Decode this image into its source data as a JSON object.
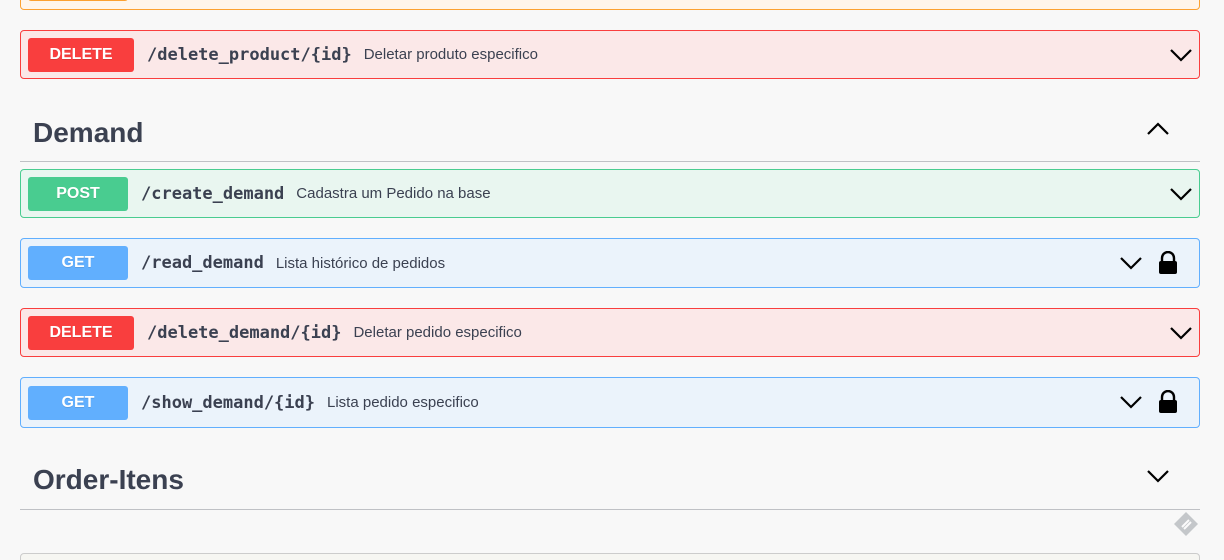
{
  "colors": {
    "delete": "#f93e3e",
    "post": "#49cc90",
    "get": "#61affe",
    "patch": "#fca130",
    "text": "#3b4151"
  },
  "operations": [
    {
      "method": "DELETE",
      "path": "/delete_product/{id}",
      "summary": "Deletar produto especifico",
      "locked": false
    },
    {
      "method": "POST",
      "path": "/create_demand",
      "summary": "Cadastra um Pedido na base",
      "locked": false
    },
    {
      "method": "GET",
      "path": "/read_demand",
      "summary": "Lista histórico de pedidos",
      "locked": true
    },
    {
      "method": "DELETE",
      "path": "/delete_demand/{id}",
      "summary": "Deletar pedido especifico",
      "locked": false
    },
    {
      "method": "GET",
      "path": "/show_demand/{id}",
      "summary": "Lista pedido especifico",
      "locked": true
    }
  ],
  "tags": [
    {
      "name": "Demand",
      "expanded": true
    },
    {
      "name": "Order-Itens",
      "expanded": false
    }
  ],
  "icons": {
    "chevron_down": "chevron-down-icon",
    "chevron_up": "chevron-up-icon",
    "lock": "lock-icon",
    "watermark": "pencil-watermark-icon"
  }
}
